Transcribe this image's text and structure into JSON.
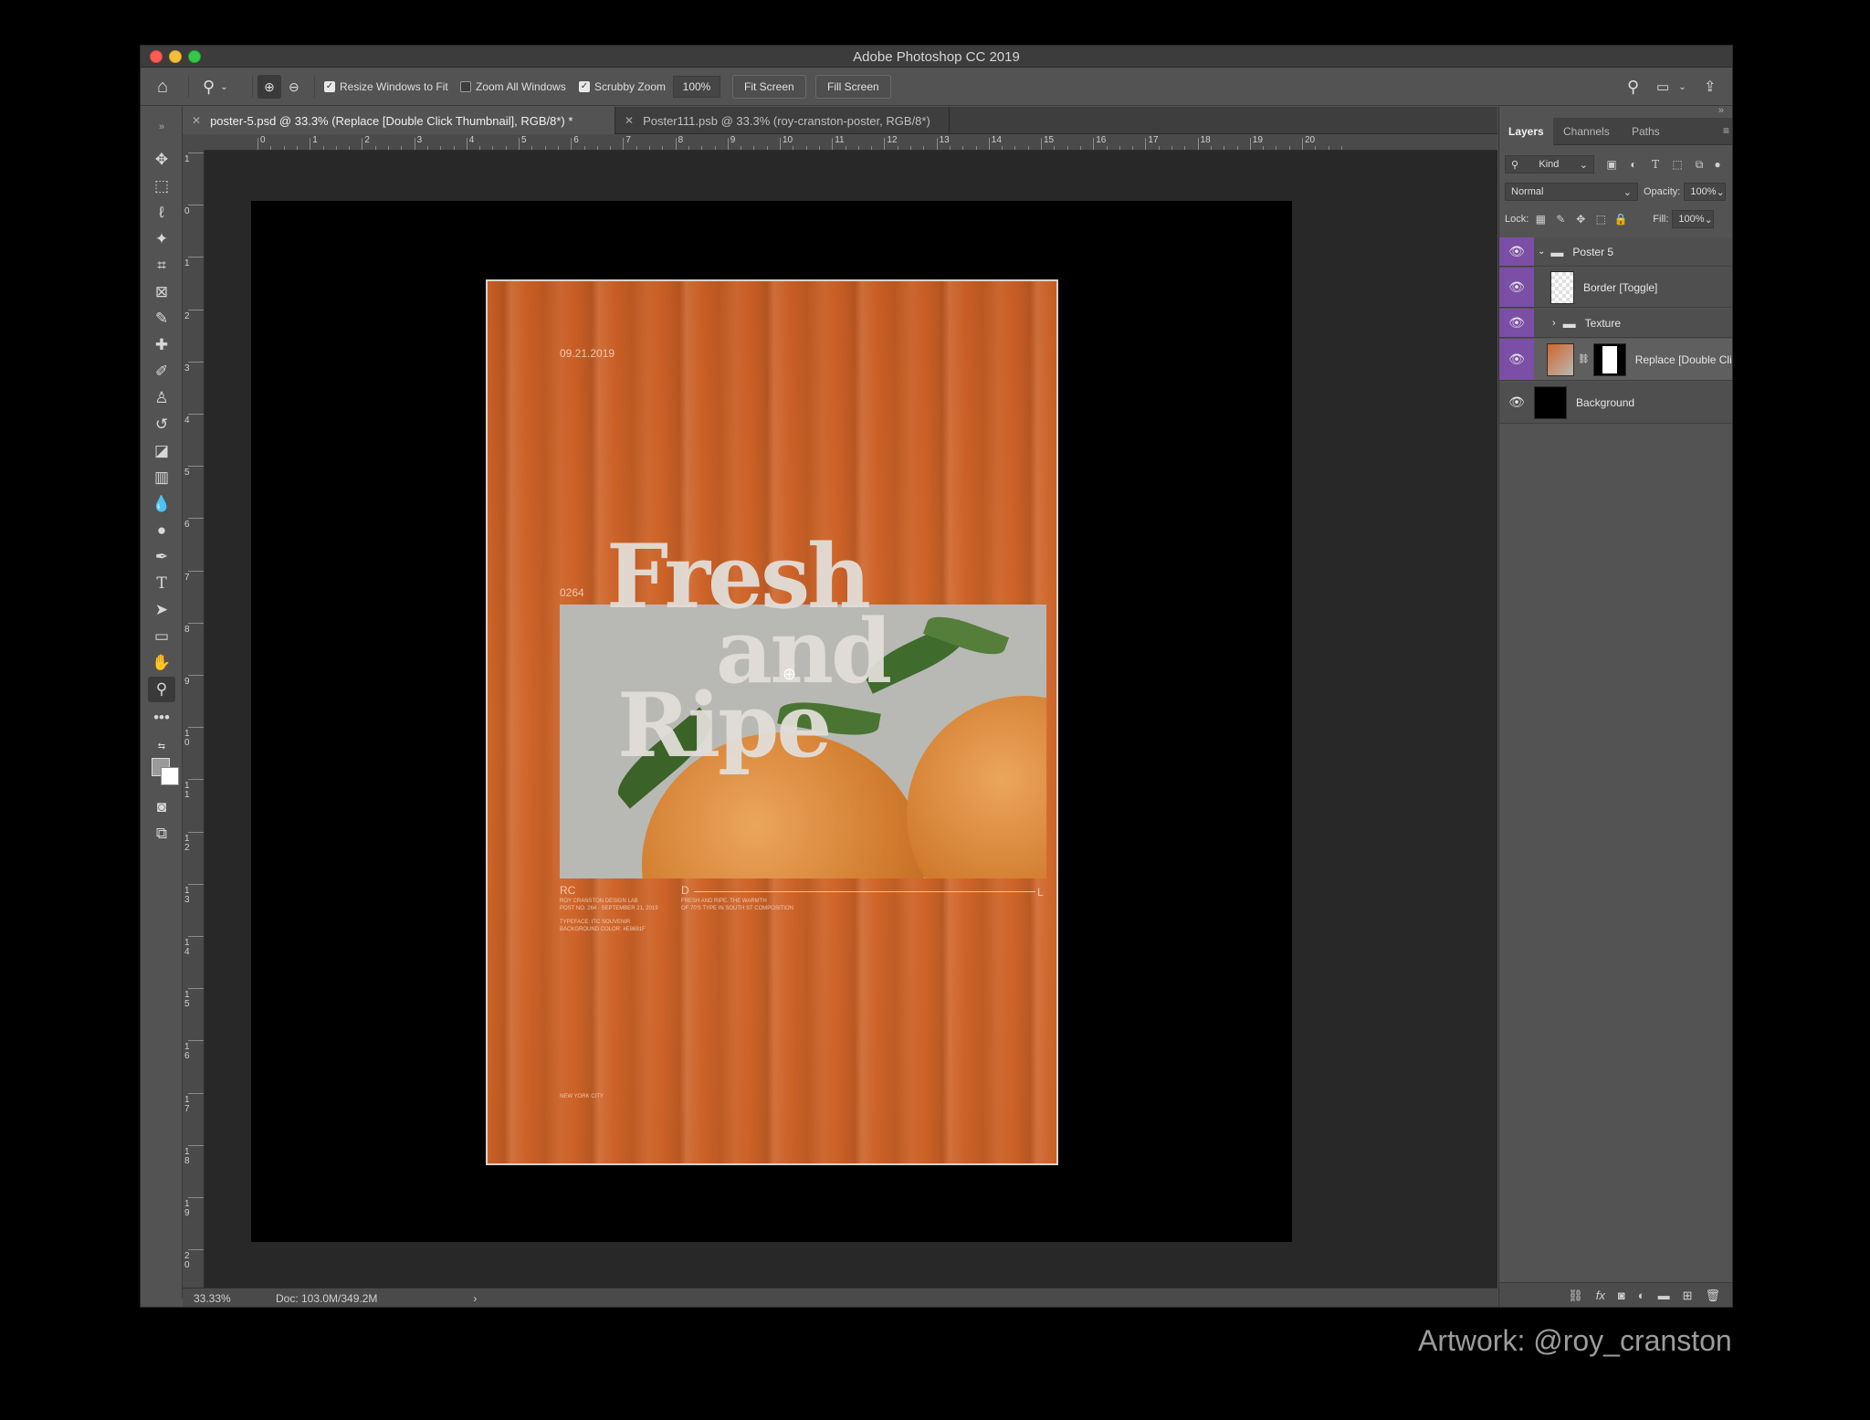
{
  "window": {
    "title": "Adobe Photoshop CC 2019"
  },
  "options": {
    "resize_windows": "Resize Windows to Fit",
    "zoom_all_windows": "Zoom All Windows",
    "scrubby_zoom": "Scrubby Zoom",
    "zoom_value": "100%",
    "fit_screen": "Fit Screen",
    "fill_screen": "Fill Screen"
  },
  "tabs": [
    {
      "label": "poster-5.psd @ 33.3% (Replace [Double Click Thumbnail], RGB/8*) *",
      "active": true
    },
    {
      "label": "Poster111.psb @ 33.3% (roy-cranston-poster, RGB/8*)",
      "active": false
    }
  ],
  "ruler_h": [
    "0",
    "1",
    "2",
    "3",
    "4",
    "5",
    "6",
    "7",
    "8",
    "9",
    "10",
    "11",
    "12",
    "13",
    "14",
    "15",
    "16",
    "17",
    "18",
    "19",
    "20"
  ],
  "ruler_v": [
    "1",
    "0",
    "1",
    "2",
    "3",
    "4",
    "5",
    "6",
    "7",
    "8",
    "9",
    "1 0",
    "1 1",
    "1 2",
    "1 3",
    "1 4",
    "1 5",
    "1 6",
    "1 7",
    "1 8",
    "1 9",
    "2 0"
  ],
  "poster": {
    "date": "09.21.2019",
    "number": "0264",
    "headline": [
      "Fresh",
      "and",
      "Ripe"
    ],
    "rc": "RC",
    "d": "D",
    "l": "L",
    "credits_left": [
      "ROY CRANSTON DESIGN LAB",
      "POST NO. 264 · SEPTEMBER 21, 2019",
      "",
      "TYPEFACE: ITC SOUVENIR",
      "BACKGROUND COLOR: #E8691F"
    ],
    "credits_right": [
      "FRESH AND RIPE. THE WARMTH",
      "OF 70'S TYPE IN SOUTH ST COMPOSITION"
    ],
    "city": "NEW YORK CITY"
  },
  "status": {
    "zoom": "33.33%",
    "doc": "Doc: 103.0M/349.2M"
  },
  "panel": {
    "tabs": [
      "Layers",
      "Channels",
      "Paths"
    ],
    "kind": "Kind",
    "blend_mode": "Normal",
    "opacity_label": "Opacity:",
    "opacity": "100%",
    "lock_label": "Lock:",
    "fill_label": "Fill:",
    "fill": "100%",
    "layers": [
      {
        "name": "Poster 5",
        "type": "group-open"
      },
      {
        "name": "Border [Toggle]",
        "type": "smart"
      },
      {
        "name": "Texture",
        "type": "group"
      },
      {
        "name": "Replace [Double Click Thumbnail]",
        "type": "smart-masked"
      },
      {
        "name": "Background",
        "type": "background"
      }
    ]
  },
  "credit": "Artwork: @roy_cranston",
  "colors": {
    "poster_orange": "#cf6428",
    "layer_eye_purple": "#7b4fa5",
    "ui_gray": "#535353"
  }
}
